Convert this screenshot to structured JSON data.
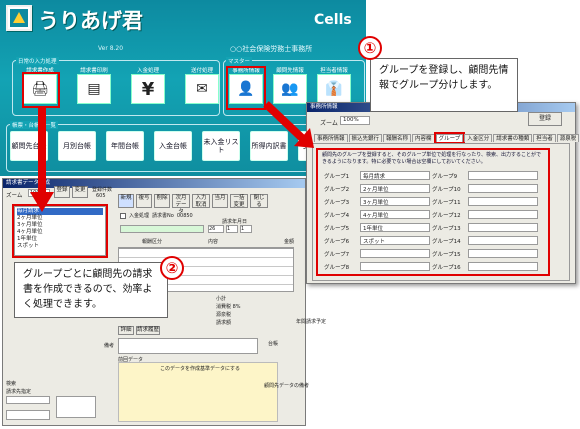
{
  "app": {
    "logo_text": "うりあげ君",
    "version": "Ver 8.20",
    "edition": "Cells",
    "office_name": "○○社会保険労務士事務所"
  },
  "sections": {
    "daily_title": "日常の入力処理",
    "master_title": "マスター",
    "ledger_title": "帳票・台帳の一覧"
  },
  "daily_tiles": [
    "請求書作成",
    "請求書印刷",
    "入金処理",
    "送付処理"
  ],
  "master_tiles": [
    "事務所情報",
    "顧問先情報",
    "担当者情報"
  ],
  "ledgers": [
    "顧問先台帳",
    "月別台帳",
    "年間台帳",
    "入金台帳",
    "未入金リスト",
    "所得内訳書",
    "支払調書"
  ],
  "callout1": {
    "number": "①",
    "text": "グループを登録し、顧問先情報でグループ分けします。"
  },
  "callout2": {
    "number": "②",
    "text": "グループごとに顧問先の請求書を作成できるので、効率よく処理できます。"
  },
  "office_window": {
    "title": "事務所情報",
    "zoom_label": "ズーム",
    "zoom_value": "100%",
    "register_button": "登録",
    "tabs": [
      "事務所情報",
      "振込先銀行",
      "報酬名称",
      "内容欄",
      "グループ",
      "入金区分",
      "請求書の種類",
      "担当者",
      "源泉税"
    ],
    "active_tab": "グループ",
    "notice": "顧問先のグループを登録すると、そのグループ単位で処理を行なったり、検索、出力することができるようになります。特に必要でない場合は空欄にしておいてください。",
    "groups_left": [
      {
        "label": "グループ1",
        "value": "毎月請求"
      },
      {
        "label": "グループ2",
        "value": "2ヶ月単位"
      },
      {
        "label": "グループ3",
        "value": "3ヶ月単位"
      },
      {
        "label": "グループ4",
        "value": "4ヶ月単位"
      },
      {
        "label": "グループ5",
        "value": "1年単位"
      },
      {
        "label": "グループ6",
        "value": "スポット"
      },
      {
        "label": "グループ7",
        "value": ""
      },
      {
        "label": "グループ8",
        "value": ""
      }
    ],
    "groups_right": [
      {
        "label": "グループ9",
        "value": ""
      },
      {
        "label": "グループ10",
        "value": ""
      },
      {
        "label": "グループ11",
        "value": ""
      },
      {
        "label": "グループ12",
        "value": ""
      },
      {
        "label": "グループ13",
        "value": ""
      },
      {
        "label": "グループ14",
        "value": ""
      },
      {
        "label": "グループ15",
        "value": ""
      },
      {
        "label": "グループ16",
        "value": ""
      }
    ]
  },
  "invoice_window": {
    "title": "請求書データ作成",
    "zoom_label": "ズーム",
    "zoom_value": "100%",
    "top_buttons": [
      "登録",
      "変更",
      "戻る",
      "進む"
    ],
    "right_buttons": [
      "新規",
      "複写",
      "削除",
      "次月データ",
      "入力取消",
      "当月",
      "一括変更",
      "閉じる"
    ],
    "count_label": "登録件数",
    "count_value": "605",
    "paid_label": "入金処理",
    "invoice_no_label": "請求書No",
    "invoice_no": "00850",
    "date_label": "請求年月日",
    "date_year": "26",
    "date_month": "1",
    "date_day": "1",
    "groups_dropdown": [
      "毎月請求",
      "2ヶ月単位",
      "3ヶ月単位",
      "4ヶ月単位",
      "1年単位",
      "スポット"
    ],
    "column_headers": [
      "報酬区分",
      "内容",
      "金額"
    ],
    "subtotal_label": "小計",
    "tax_label": "消費税",
    "tax_rate": "8%",
    "withholding_label": "源泉税",
    "total_label": "請求額",
    "remarks_label": "備考",
    "detail_button": "詳細",
    "history_button": "請求履歴",
    "previous_data_label": "前回データ",
    "search_header": "このデータを作成基準データにする",
    "search_label": "検索",
    "client_search_label": "請求先指定",
    "print_label": "印刷",
    "remaining_label": "残",
    "ledger_label": "台帳",
    "note_label": "顧問先データの備考",
    "invoice_note_label": "年間請求予定"
  }
}
